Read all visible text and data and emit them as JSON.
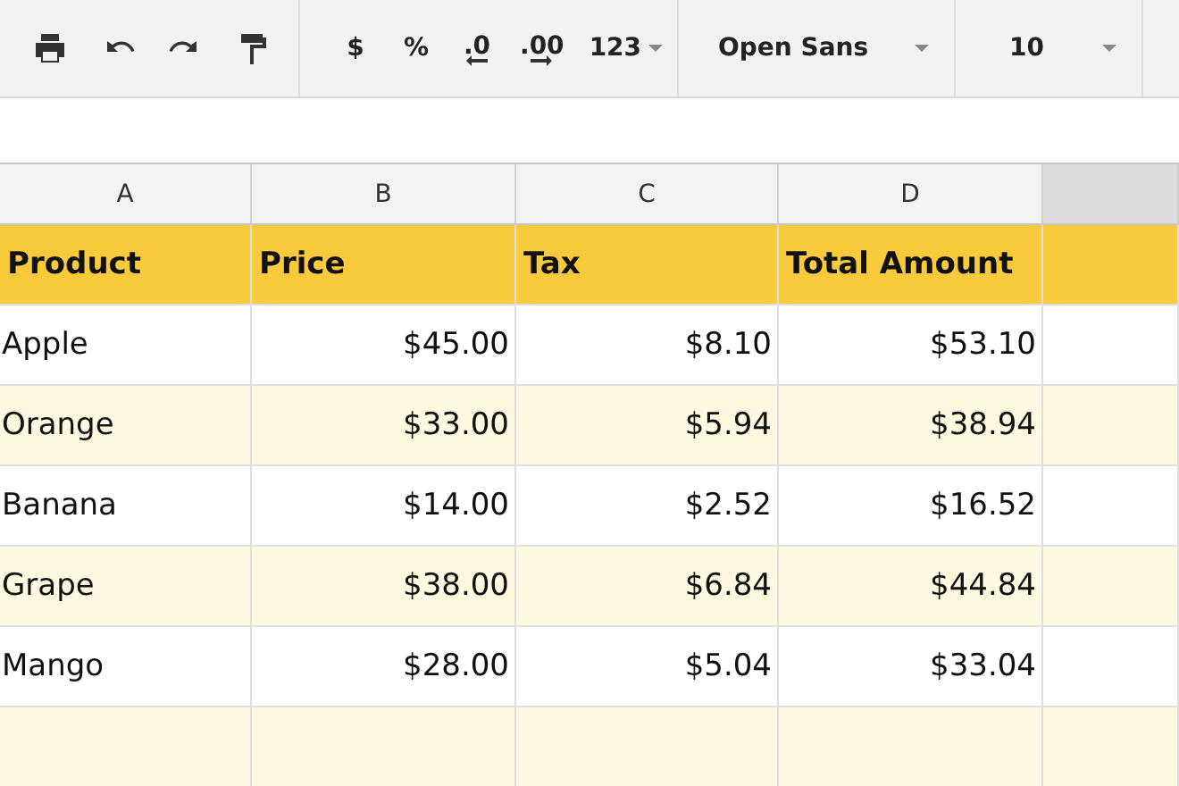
{
  "toolbar": {
    "format_buttons": [
      "$",
      "%",
      ".0",
      ".00"
    ],
    "number_format": "123",
    "font": "Open Sans",
    "font_size": "10"
  },
  "columns": [
    "A",
    "B",
    "C",
    "D"
  ],
  "header_row": [
    "Product",
    "Price",
    "Tax",
    "Total Amount"
  ],
  "rows": [
    {
      "product": "Apple",
      "price": "$45.00",
      "tax": "$8.10",
      "total": "$53.10"
    },
    {
      "product": "Orange",
      "price": "$33.00",
      "tax": "$5.94",
      "total": "$38.94"
    },
    {
      "product": "Banana",
      "price": "$14.00",
      "tax": "$2.52",
      "total": "$16.52"
    },
    {
      "product": "Grape",
      "price": "$38.00",
      "tax": "$6.84",
      "total": "$44.84"
    },
    {
      "product": "Mango",
      "price": "$28.00",
      "tax": "$5.04",
      "total": "$33.04"
    }
  ]
}
